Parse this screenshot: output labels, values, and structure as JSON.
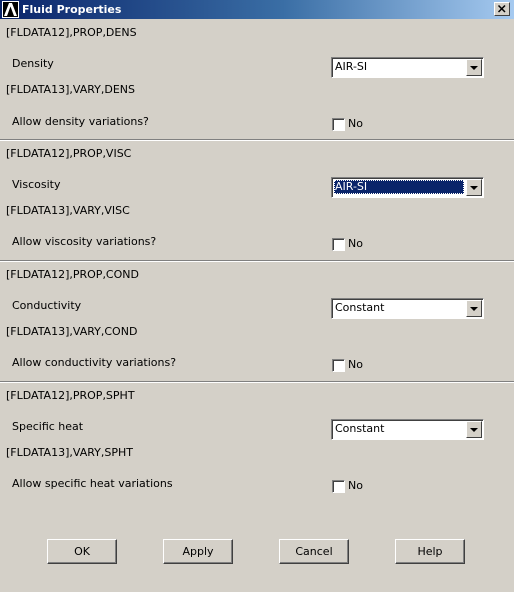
{
  "window": {
    "title": "Fluid Properties",
    "logo_icon": "ansys-logo-icon",
    "close_icon": "close-icon"
  },
  "sections": [
    {
      "prop_cmd": "[FLDATA12],PROP,DENS",
      "prop_label": "Density",
      "prop_value": "AIR-SI",
      "vary_cmd": "[FLDATA13],VARY,DENS",
      "vary_label": "Allow density variations?",
      "vary_value": "No",
      "vary_checked": false
    },
    {
      "prop_cmd": "[FLDATA12],PROP,VISC",
      "prop_label": "Viscosity",
      "prop_value": "AIR-SI",
      "prop_focused": true,
      "vary_cmd": "[FLDATA13],VARY,VISC",
      "vary_label": "Allow viscosity variations?",
      "vary_value": "No",
      "vary_checked": false
    },
    {
      "prop_cmd": "[FLDATA12],PROP,COND",
      "prop_label": "Conductivity",
      "prop_value": "Constant",
      "vary_cmd": "[FLDATA13],VARY,COND",
      "vary_label": "Allow conductivity variations?",
      "vary_value": "No",
      "vary_checked": false
    },
    {
      "prop_cmd": "[FLDATA12],PROP,SPHT",
      "prop_label": "Specific heat",
      "prop_value": "Constant",
      "vary_cmd": "[FLDATA13],VARY,SPHT",
      "vary_label": "Allow specific heat variations",
      "vary_value": "No",
      "vary_checked": false
    }
  ],
  "buttons": {
    "ok": "OK",
    "apply": "Apply",
    "cancel": "Cancel",
    "help": "Help"
  },
  "colors": {
    "titlebar_start": "#0a246a",
    "titlebar_end": "#a6caf0",
    "dialog_bg": "#d4d0c8",
    "selection": "#0a246a"
  }
}
